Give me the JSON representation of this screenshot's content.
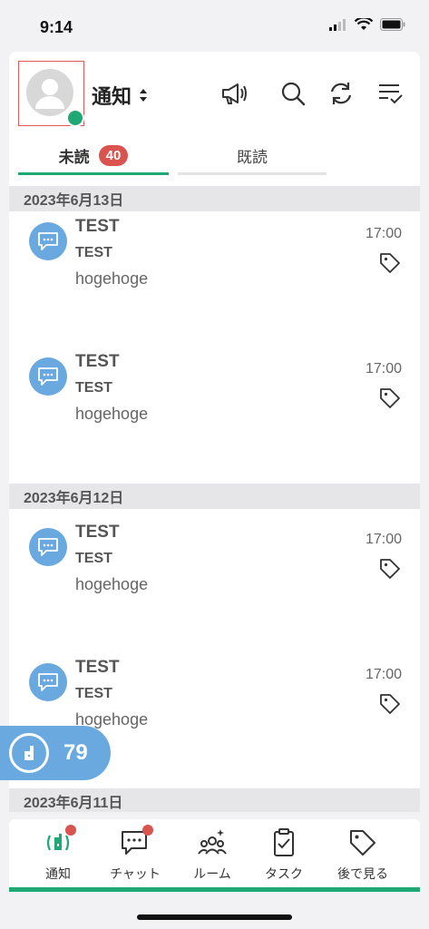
{
  "status_bar": {
    "time": "9:14"
  },
  "header": {
    "title": "通知"
  },
  "tabs": [
    {
      "label": "未読",
      "count": "40"
    },
    {
      "label": "既読"
    }
  ],
  "sections": [
    {
      "date": "2023年6月13日"
    },
    {
      "date": "2023年6月12日"
    },
    {
      "date": "2023年6月11日"
    }
  ],
  "items": [
    {
      "title": "TEST",
      "subtitle": "TEST",
      "body": "hogehoge",
      "time": "17:00"
    },
    {
      "title": "TEST",
      "subtitle": "TEST",
      "body": "hogehoge",
      "time": "17:00"
    },
    {
      "title": "TEST",
      "subtitle": "TEST",
      "body": "hogehoge",
      "time": "17:00"
    },
    {
      "title": "TEST",
      "subtitle": "TEST",
      "body": "hogehoge",
      "time": "17:00"
    }
  ],
  "float_badge": {
    "count": "79"
  },
  "bottom_nav": [
    {
      "label": "通知",
      "icon": "notification-icon"
    },
    {
      "label": "チャット",
      "icon": "chat-icon"
    },
    {
      "label": "ルーム",
      "icon": "room-icon"
    },
    {
      "label": "タスク",
      "icon": "task-icon"
    },
    {
      "label": "後で見る",
      "icon": "tag-icon"
    }
  ],
  "colors": {
    "accent": "#1fa874",
    "badge": "#d9534f",
    "icon_bg": "#6aa8e0"
  }
}
